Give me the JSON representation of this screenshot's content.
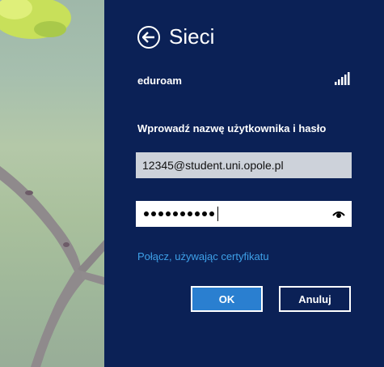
{
  "header": {
    "title": "Sieci",
    "back_icon": "back-arrow-icon"
  },
  "network": {
    "name": "eduroam",
    "signal_icon": "wifi-signal-icon",
    "signal_bars": 5
  },
  "auth": {
    "prompt": "Wprowadź nazwę użytkownika i hasło",
    "username_value": "12345@student.uni.opole.pl",
    "password_mask_length": 10,
    "reveal_icon": "eye-icon"
  },
  "links": {
    "certificate": "Połącz, używając certyfikatu"
  },
  "buttons": {
    "ok": "OK",
    "cancel": "Anuluj"
  },
  "colors": {
    "panel": "#0b2156",
    "accent": "#2a7fd0",
    "link": "#3ea0e8"
  }
}
